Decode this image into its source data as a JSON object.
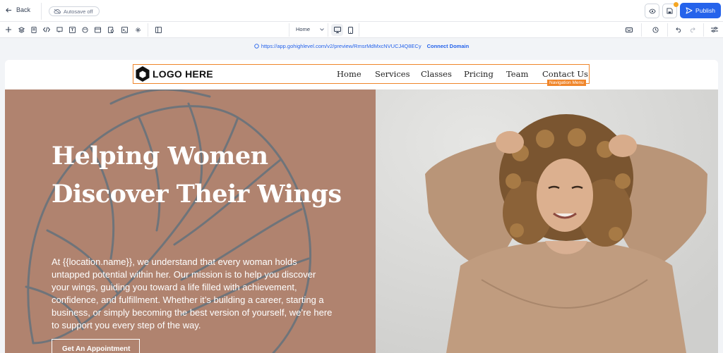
{
  "topbar": {
    "back_label": "Back",
    "autosave_label": "Autosave off",
    "publish_label": "Publish"
  },
  "toolbar": {
    "page_select": "Home"
  },
  "urlbar": {
    "preview_url": "https://app.gohighlevel.com/v2/preview/RmsrMdMxcNVUCJ4Q8ECy",
    "connect_label": "Connect Domain"
  },
  "site": {
    "logo_text": "LOGO HERE",
    "nav_selection_tag": "Navigation Menu",
    "nav_items": [
      "Home",
      "Services",
      "Classes",
      "Pricing",
      "Team",
      "Contact Us"
    ],
    "headline": "Helping Women Discover Their Wings",
    "body": "At {{location.name}}, we understand that every woman holds untapped potential within her. Our mission is to help you discover your wings, guiding you toward a life filled with achievement, confidence, and fulfillment. Whether it’s building a career, starting a business, or simply becoming the best version of yourself, we’re here to support you every step of the way.",
    "cta_label": "Get An Appointment"
  },
  "colors": {
    "accent": "#2563eb",
    "selection": "#f0862b",
    "hero_left_bg": "#b0836f",
    "leaf_line": "#6f747a"
  }
}
